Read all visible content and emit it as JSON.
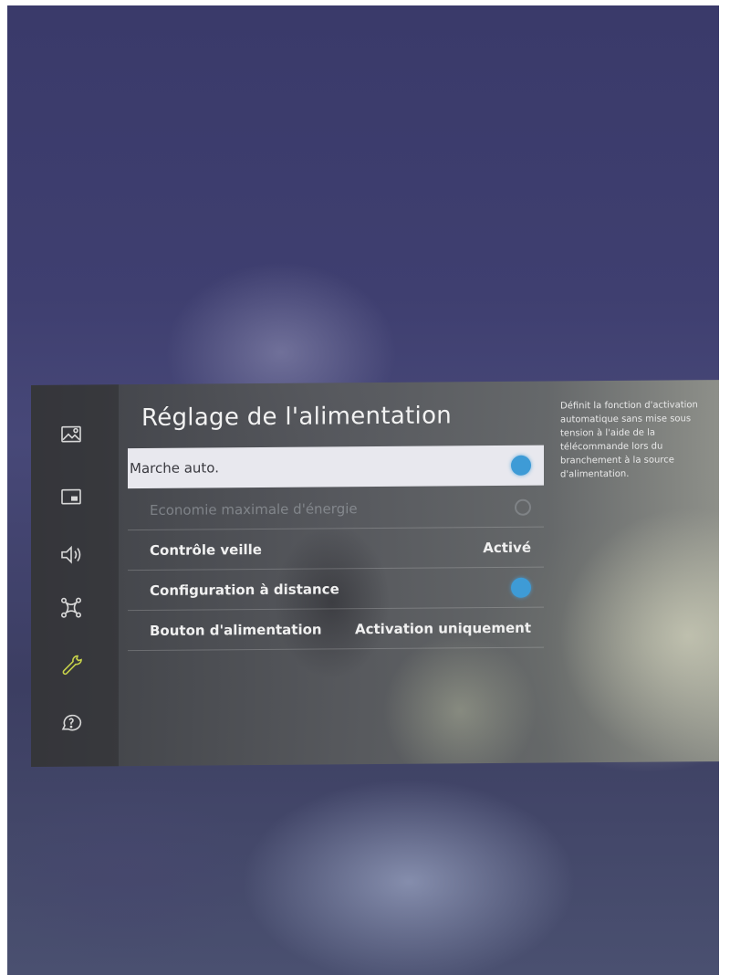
{
  "panel": {
    "title": "Réglage de l'alimentation",
    "description": "Définit la fonction d'activation automatique sans mise sous tension à l'aide de la télécommande lors du branchement à la source d'alimentation."
  },
  "sidebar": {
    "items": [
      {
        "icon": "picture-icon"
      },
      {
        "icon": "picture-in-picture-icon"
      },
      {
        "icon": "sound-icon"
      },
      {
        "icon": "network-icon"
      },
      {
        "icon": "wrench-icon",
        "selected": true
      },
      {
        "icon": "support-icon"
      }
    ]
  },
  "menu": {
    "items": [
      {
        "label": "Marche auto.",
        "control": "toggle",
        "state": "on",
        "focused": true
      },
      {
        "label": "Economie maximale d'énergie",
        "control": "toggle",
        "state": "disabled"
      },
      {
        "label": "Contrôle veille",
        "value": "Activé"
      },
      {
        "label": "Configuration à distance",
        "control": "toggle",
        "state": "on"
      },
      {
        "label": "Bouton d'alimentation",
        "value": "Activation uniquement"
      }
    ]
  },
  "colors": {
    "toggle_on": "#3e9bd6",
    "focus_bg": "#e8e8ee",
    "panel_bg": "#4a4c50"
  }
}
